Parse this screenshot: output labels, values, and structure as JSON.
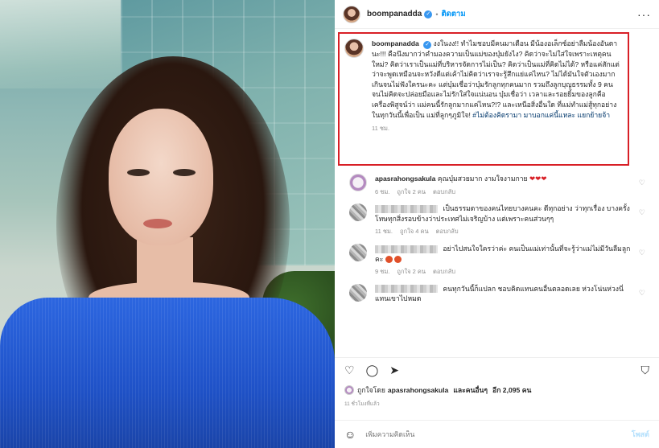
{
  "header": {
    "username": "boompanadda",
    "follow_label": "ติดตาม",
    "more_icon": "more-icon"
  },
  "caption": {
    "username": "boompanadda",
    "text": "งงในงง!! ทำไมชอบมีคนมาเตือน มีน้องอเล็กซ์อย่าลืมน้องอันดานะ!!! คือนึงมากว่าคำมองความเป็นแม่ของบุ๋มยังไง? คิดว่าจะไม่ใส่ใจเพราะเหตุคนใหม่? คิดว่าเราเป็นแม่ที่บริหารจัดการไม่เป็น? คิดว่าเป็นแม่ที่คิดไม่ได้? หรือแค่สักแต่ว่าจะพูดเหมือนจะหวังดีแต่เค้าไม่คิดว่าเราจะรู้สึกแย่แค่ไหน? ไม่ได้มันใจตัวเองมากเกินจนไม่ฟังใครนะคะ แต่บุ๋มเชื่อว่าบุ๋มรักลูกทุกคนมาก รวมถึงลูกบุญธรรมทั้ง 9 คน จนไม่คิดจะปล่อยมือและไม่รักใส่ใจแน่นอน บุ๋มเชื่อว่า เวลาและรอยยิ้มของลูกคือเครื่องพิสูจน์ว่า แม่คนนี้รักลูกมากแค่ไหน?!? และเหนือสิ่งอื่นใด ที่แม่ทำแม่สู้ทุกอย่างในทุกวันนี้เพื่อเป็น แม่ที่ลูกๆภูมิใจ!",
    "hashtag": "#ไม่ต้องคิดรามา มาบอกแค่นี้แหละ แยกย้ายจ้า",
    "time": "11 ชม."
  },
  "comments": [
    {
      "username": "apasrahongsakula",
      "text": "คุณบุ๋มสวยมาก งามใจงามกาย",
      "emoji": "❤❤❤",
      "time": "6 ชม.",
      "likes": "ถูกใจ 2 คน",
      "reply": "ตอบกลับ"
    },
    {
      "username": "",
      "text": "เป็นธรรมดาของคนไทยบางคนคะ ดีทุกอย่าง ว่าทุกเรื่อง บางครั้งโทษทุกสิ่งรอบข้างว่าประเทศไม่เจริญบ้าง แต่เพราะคนส่วนๆๆ",
      "time": "11 ชม.",
      "likes": "ถูกใจ 4 คน",
      "reply": "ตอบกลับ"
    },
    {
      "username": "",
      "text": "อย่าไปสนใจใครว่าค่ะ คนเป็นแม่เท่านั้นที่จะรู้ว่าแม่ไม่มีวันลืมลูกคะ",
      "time": "9 ชม.",
      "likes": "ถูกใจ 2 คน",
      "reply": "ตอบกลับ"
    },
    {
      "username": "",
      "text": "คนทุกวันนี้ก็แปลก ชอบคิดแทนคนอื่นตลอดเลย ห่วงโน่นห่วงนี่แทนเขาไปหมด",
      "time": "",
      "likes": "",
      "reply": ""
    }
  ],
  "likes_line": {
    "prefix": "ถูกใจโดย",
    "user": "apasrahongsakula",
    "middle": "และคนอื่นๆ",
    "suffix": "อีก 2,095 คน"
  },
  "post_time": "11 ชั่วโมงที่แล้ว",
  "add_comment": {
    "placeholder": "เพิ่มความคิดเห็น",
    "post_label": "โพสต์"
  },
  "icons": [
    "heart-icon",
    "comment-icon",
    "share-icon",
    "bookmark-icon",
    "emoji-icon"
  ],
  "colors": {
    "accent": "#0095f6",
    "highlight_border": "#d81f26",
    "dress": "#2c66e0"
  }
}
